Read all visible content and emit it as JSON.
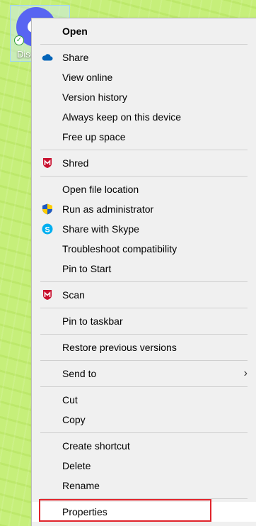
{
  "desktop": {
    "icon_label": "Disc"
  },
  "menu": {
    "items": [
      {
        "label": "Open"
      },
      {
        "label": "Share"
      },
      {
        "label": "View online"
      },
      {
        "label": "Version history"
      },
      {
        "label": "Always keep on this device"
      },
      {
        "label": "Free up space"
      },
      {
        "label": "Shred"
      },
      {
        "label": "Open file location"
      },
      {
        "label": "Run as administrator"
      },
      {
        "label": "Share with Skype"
      },
      {
        "label": "Troubleshoot compatibility"
      },
      {
        "label": "Pin to Start"
      },
      {
        "label": "Scan"
      },
      {
        "label": "Pin to taskbar"
      },
      {
        "label": "Restore previous versions"
      },
      {
        "label": "Send to"
      },
      {
        "label": "Cut"
      },
      {
        "label": "Copy"
      },
      {
        "label": "Create shortcut"
      },
      {
        "label": "Delete"
      },
      {
        "label": "Rename"
      },
      {
        "label": "Properties"
      }
    ]
  },
  "colors": {
    "desktop_bg": "#c6ef7a",
    "menu_bg": "#f0f0f0",
    "highlight_border": "#e0242b",
    "mcafee_red": "#c8102e",
    "onedrive_blue": "#0364b8",
    "skype_blue": "#00aff0"
  }
}
